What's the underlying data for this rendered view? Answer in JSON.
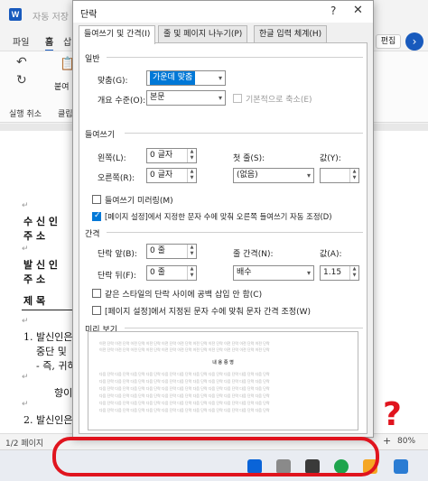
{
  "word": {
    "title": "자동 저장",
    "ribbon_tabs": [
      "파일",
      "홈",
      "삽"
    ],
    "undo_label": "실행 취소",
    "clipboard_label": "클립",
    "paste_label": "붙여",
    "edit_label": "편집",
    "status_page": "1/2 페이지",
    "zoom": "80%"
  },
  "document": {
    "lines": [
      {
        "text": "수 신 인",
        "bold": true
      },
      {
        "text": "주    소",
        "bold": true
      },
      {
        "text": "발 신 인",
        "bold": true
      },
      {
        "text": "주    소",
        "bold": true
      },
      {
        "text": "제    목",
        "bold": true
      },
      {
        "text": "1. 발신인은",
        "bold": false
      },
      {
        "text": "중단  및",
        "bold": false
      },
      {
        "text": "- 즉, 귀하",
        "bold": false
      },
      {
        "text": "향이",
        "bold": false
      },
      {
        "text": "2. 발신인은",
        "bold": false
      }
    ]
  },
  "dialog": {
    "title": "단락",
    "help": "?",
    "close": "✕",
    "tabs": [
      {
        "label": "들여쓰기 및 간격(I)",
        "active": true
      },
      {
        "label": "줄 및 페이지 나누기(P)",
        "active": false
      },
      {
        "label": "한글 입력 체계(H)",
        "active": false
      }
    ],
    "general": {
      "section": "일반",
      "alignment_label": "맞춤(G):",
      "alignment_value": "가운데 맞춤",
      "outline_label": "개요 수준(O):",
      "outline_value": "본문",
      "collapsed_label": "기본적으로 축소(E)"
    },
    "indent": {
      "section": "들여쓰기",
      "left_label": "왼쪽(L):",
      "left_value": "0 글자",
      "right_label": "오른쪽(R):",
      "right_value": "0 글자",
      "first_label": "첫 줄(S):",
      "first_value": "(없음)",
      "by_label": "값(Y):",
      "mirror_label": "들여쓰기 미러링(M)",
      "auto_adjust_label": "[페이지 설정]에서 지정한 문자 수에 맞춰 오른쪽 들여쓰기 자동 조정(D)"
    },
    "spacing": {
      "section": "간격",
      "before_label": "단락 앞(B):",
      "before_value": "0 줄",
      "after_label": "단락 뒤(F):",
      "after_value": "0 줄",
      "line_label": "줄 간격(N):",
      "line_value": "배수",
      "at_label": "값(A):",
      "at_value": "1.15",
      "same_style_label": "같은 스타일의 단락 사이에 공백 삽입 안 함(C)",
      "grid_label": "[페이지 설정]에서 지정된 문자 수에 맞춰 문자 간격 조정(W)"
    },
    "preview": {
      "section": "미리 보기",
      "sample_line": "이전 단락 이전 단락 이전 단락 이전 단락 이전 단락 이전 단락 이전 단락 이전 단락 이전 단락 이전 단락 이전 단락",
      "title_text": "내 용 증 명",
      "next_line": "다음 단락 다음 단락 다음 단락 다음 단락 다음 단락 다음 단락 다음 단락 다음 단락 다음 단락 다음 단락 다음 단락"
    }
  },
  "annotation": {
    "question_mark": "?"
  },
  "colors": {
    "accent": "#0078d7",
    "word_blue": "#185abd",
    "annotation_red": "#e0141e"
  }
}
